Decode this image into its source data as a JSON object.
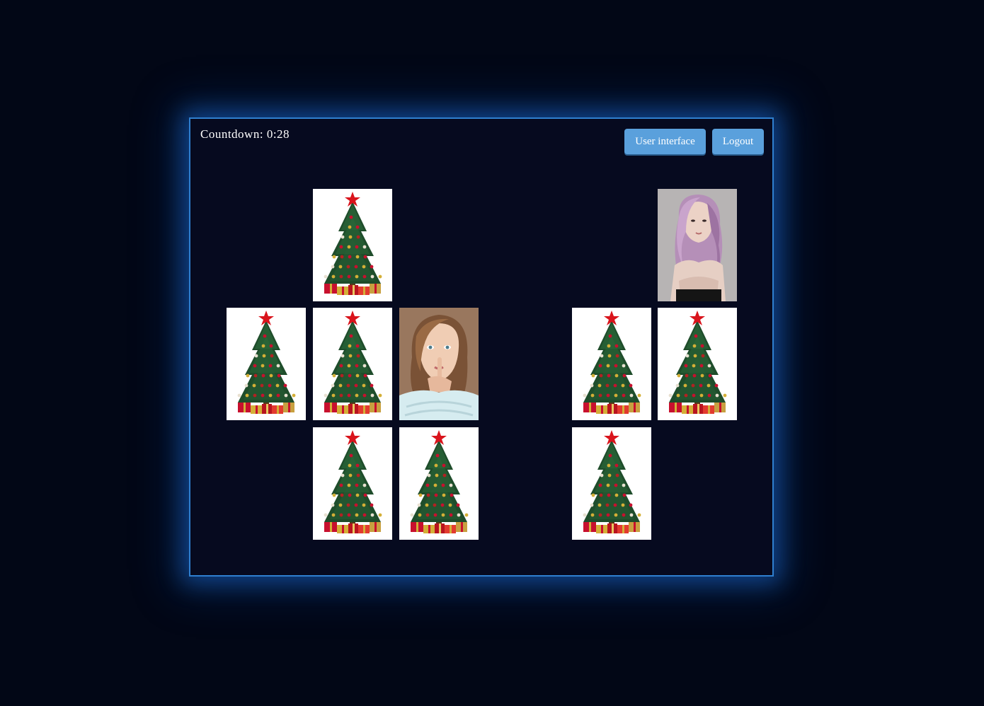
{
  "header": {
    "countdown_label": "Countdown:",
    "countdown_value": "0:28"
  },
  "buttons": {
    "user_interface": "User interface",
    "logout": "Logout"
  },
  "colors": {
    "background": "#020716",
    "panel": "#060a1f",
    "panel_border": "#2f7fcf",
    "button": "#5aa0dc"
  },
  "cards": [
    {
      "row": 0,
      "col": 1,
      "face": "christmas-tree"
    },
    {
      "row": 0,
      "col": 5,
      "face": "portrait-pink-hair"
    },
    {
      "row": 1,
      "col": 0,
      "face": "christmas-tree"
    },
    {
      "row": 1,
      "col": 1,
      "face": "christmas-tree"
    },
    {
      "row": 1,
      "col": 2,
      "face": "portrait-blonde"
    },
    {
      "row": 1,
      "col": 4,
      "face": "christmas-tree"
    },
    {
      "row": 1,
      "col": 5,
      "face": "christmas-tree"
    },
    {
      "row": 2,
      "col": 1,
      "face": "christmas-tree"
    },
    {
      "row": 2,
      "col": 2,
      "face": "christmas-tree"
    },
    {
      "row": 2,
      "col": 4,
      "face": "christmas-tree"
    }
  ]
}
